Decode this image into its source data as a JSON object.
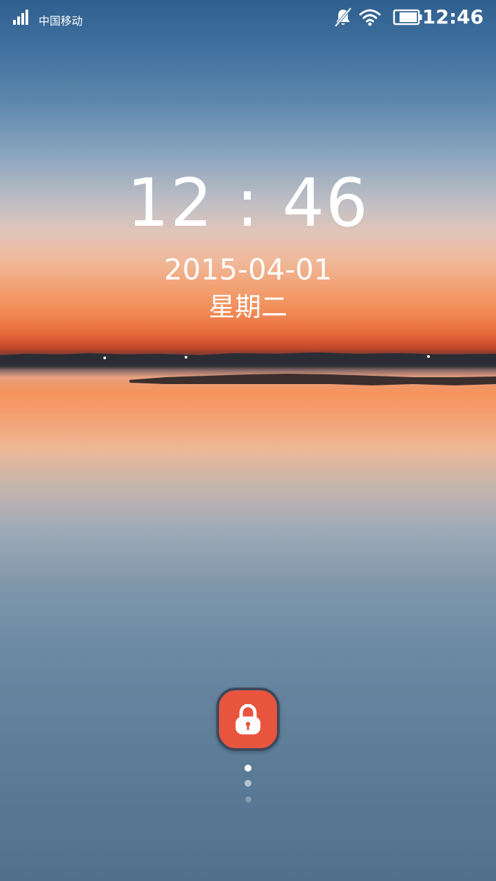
{
  "status_bar": {
    "carrier": "中国移动",
    "time": "12:46",
    "icons": [
      "signal-icon",
      "mute-icon",
      "wifi-icon",
      "battery-icon"
    ]
  },
  "lockscreen": {
    "clock": "12 : 46",
    "date": "2015-04-01",
    "weekday": "星期二"
  },
  "unlock": {
    "icon": "lock-icon",
    "color": "#e9543f"
  },
  "page_indicator": {
    "count": 3,
    "active": 1
  }
}
